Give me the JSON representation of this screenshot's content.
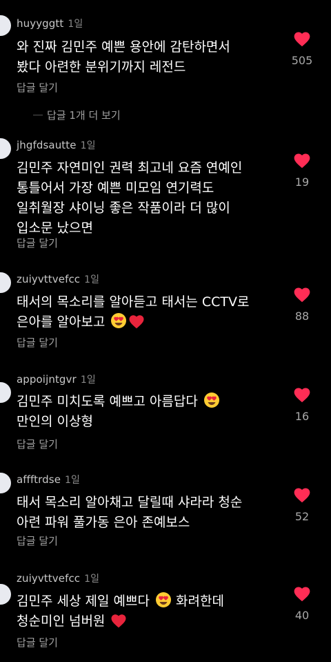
{
  "comments": [
    {
      "username": "huyyggtt",
      "time": "1일",
      "lines": [
        "와 진짜 김민주 예쁜 용안에 감탄하면서",
        "봤다 아련한 분위기까지 레전드"
      ],
      "reply_label": "답글 달기",
      "likes": "505"
    },
    {
      "username": "jhgfdsautte",
      "time": "1일",
      "lines": [
        "김민주 자연미인 권력 최고네 요즘 연예인",
        "통틀어서 가장 예쁜 미모임  연기력도",
        "일취월장  샤이닝 좋은 작품이라 더 많이",
        "입소문 났으면"
      ],
      "reply_label": "답글 달기",
      "likes": "19"
    },
    {
      "username": "zuiyvttvefcc",
      "time": "1일",
      "lines": [
        "태서의 목소리를 알아듣고 태서는 CCTV로",
        "은아를 알아보고"
      ],
      "reply_label": "답글 달기",
      "likes": "88"
    },
    {
      "username": "appoijntgvr",
      "time": "1일",
      "lines": [
        "김민주 미치도록 예쁘고 아름답다",
        "만인의 이상형"
      ],
      "reply_label": "답글 달기",
      "likes": "16"
    },
    {
      "username": "affftrdse",
      "time": "1일",
      "lines": [
        "태서 목소리 알아채고 달릴때 샤라라 청순",
        "아련 파워 풀가동  은아  존예보스"
      ],
      "reply_label": "답글 달기",
      "likes": "52"
    },
    {
      "username": "zuiyvttvefcc",
      "time": "1일",
      "lines": [
        "김민주 세상 제일 예쁘다",
        "청순미인 넘버원"
      ],
      "line1_suffix": "화려한데",
      "reply_label": "답글 달기",
      "likes": "40"
    }
  ],
  "more_replies_label": "답글 1개 더 보기",
  "colors": {
    "background": "#000000",
    "heart": "#ff2d55",
    "text": "#ffffff",
    "secondary_text": "#a0a0a0"
  },
  "icons": {
    "like": "heart-icon",
    "emoji_love": "heart-eyes-emoji",
    "emoji_heart": "red-heart-emoji"
  }
}
